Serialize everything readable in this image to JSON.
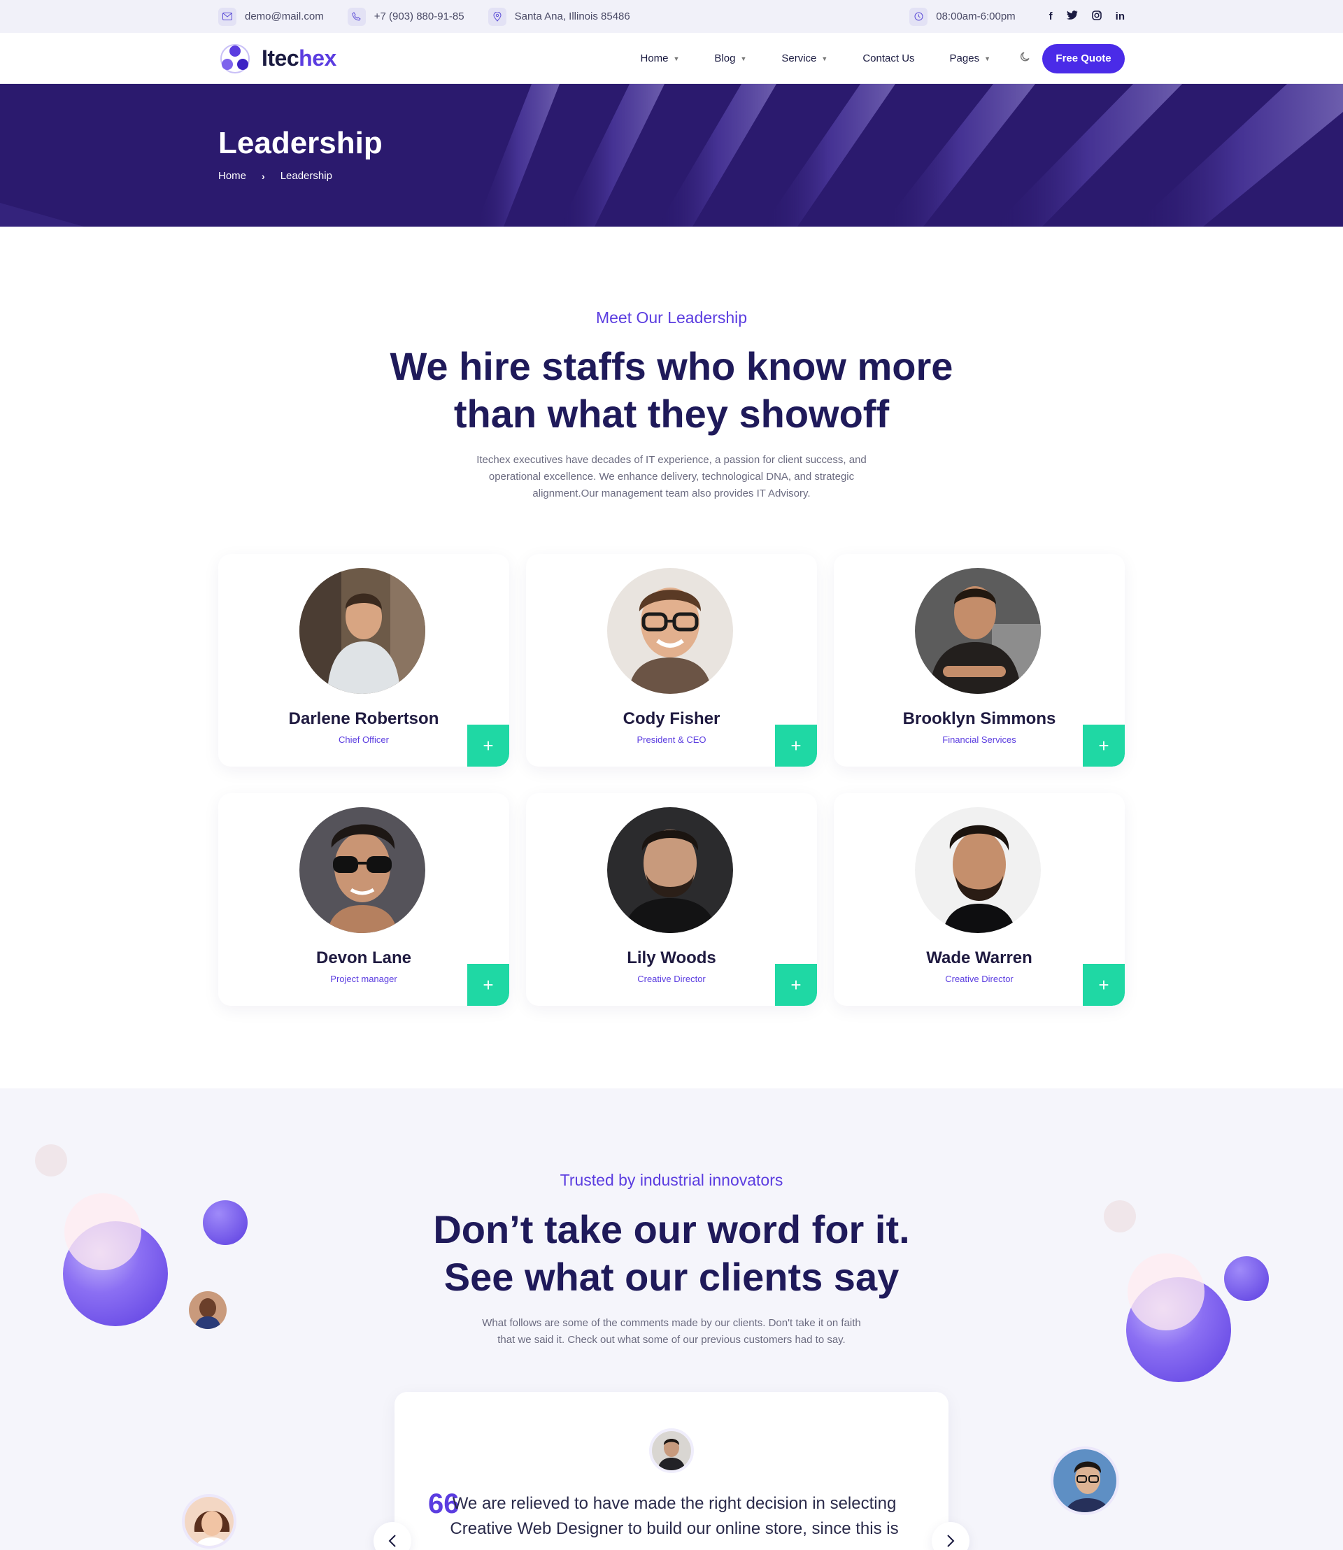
{
  "topbar": {
    "email": "demo@mail.com",
    "phone": "+7 (903) 880-91-85",
    "address": "Santa Ana, Illinois 85486",
    "hours": "08:00am-6:00pm",
    "social": [
      "f",
      "t",
      "ig",
      "in"
    ]
  },
  "nav": {
    "logo_part1": "Itec",
    "logo_part2": "hex",
    "links": [
      {
        "label": "Home",
        "dropdown": true
      },
      {
        "label": "Blog",
        "dropdown": true
      },
      {
        "label": "Service",
        "dropdown": true
      },
      {
        "label": "Contact Us",
        "dropdown": false
      },
      {
        "label": "Pages",
        "dropdown": true
      }
    ],
    "quote_button": "Free Quote"
  },
  "hero": {
    "title": "Leadership",
    "breadcrumb_home": "Home",
    "breadcrumb_sep": "›",
    "breadcrumb_current": "Leadership"
  },
  "leadership": {
    "eyebrow": "Meet Our Leadership",
    "title_line1": "We hire staffs who know more",
    "title_line2": "than what they showoff",
    "para_line1": "Itechex executives have decades of IT experience, a passion for client success, and",
    "para_line2": "operational excellence. We enhance delivery, technological DNA, and strategic",
    "para_line3": "alignment.Our management team also provides IT Advisory.",
    "members": [
      {
        "name": "Darlene Robertson",
        "role": "Chief Officer"
      },
      {
        "name": "Cody Fisher",
        "role": "President & CEO"
      },
      {
        "name": "Brooklyn Simmons",
        "role": "Financial Services"
      },
      {
        "name": "Devon Lane",
        "role": "Project manager"
      },
      {
        "name": "Lily Woods",
        "role": "Creative Director"
      },
      {
        "name": "Wade Warren",
        "role": "Creative Director"
      }
    ],
    "plus_symbol": "+"
  },
  "testimonials": {
    "eyebrow": "Trusted by industrial innovators",
    "title_line1": "Don’t take our word for it.",
    "title_line2": "See what our clients say",
    "para_line1": "What follows are some of the comments made by our clients. Don't take it on faith",
    "para_line2": "that we said it. Check out what some of our previous customers had to say.",
    "quote_mark": "66",
    "quote": "We are relieved to have made the right decision in selecting Creative Web Designer to build our online store, since this is our"
  },
  "colors": {
    "accent": "#4a2be8",
    "brand_purple": "#5b3de0",
    "hero_bg": "#2b1a6e",
    "green": "#1fd8a4"
  },
  "icons": {
    "email": "mail-icon",
    "phone": "phone-icon",
    "address": "location-pin-icon",
    "hours": "clock-icon",
    "theme": "moon-icon"
  }
}
